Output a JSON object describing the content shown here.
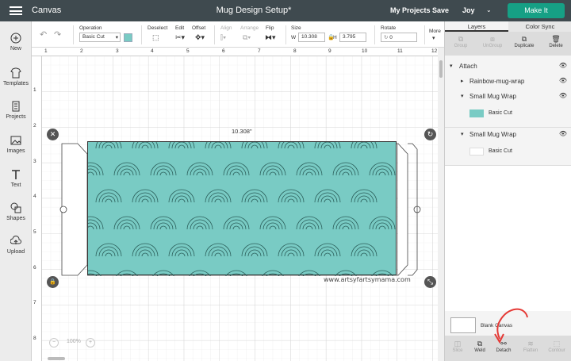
{
  "app": {
    "name": "Canvas",
    "title": "Mug Design Setup*",
    "my_projects": "My Projects",
    "save": "Save",
    "user": "Joy",
    "make_it": "Make It"
  },
  "sidebar": {
    "items": [
      {
        "label": "New"
      },
      {
        "label": "Templates"
      },
      {
        "label": "Projects"
      },
      {
        "label": "Images"
      },
      {
        "label": "Text"
      },
      {
        "label": "Shapes"
      },
      {
        "label": "Upload"
      }
    ]
  },
  "toolbar": {
    "operation_label": "Operation",
    "operation_value": "Basic Cut",
    "deselect": "Deselect",
    "edit": "Edit",
    "offset": "Offset",
    "align": "Align",
    "arrange": "Arrange",
    "flip": "Flip",
    "size_label": "Size",
    "w_label": "W",
    "w_value": "10.308",
    "h_label": "H",
    "h_value": "3.795",
    "rotate_label": "Rotate",
    "rotate_value": "0",
    "more": "More"
  },
  "rulers": {
    "h": [
      "1",
      "2",
      "3",
      "4",
      "5",
      "6",
      "7",
      "8",
      "9",
      "10",
      "11",
      "12"
    ],
    "v": [
      "1",
      "2",
      "3",
      "4",
      "5",
      "6",
      "7",
      "8"
    ]
  },
  "canvas": {
    "width_label": "10.308\"",
    "zoom": "100%",
    "watermark": "www.artsyfartsymama.com",
    "accent": "#79cbc4"
  },
  "panel": {
    "tabs": [
      "Layers",
      "Color Sync"
    ],
    "tools": [
      "Group",
      "UnGroup",
      "Duplicate",
      "Delete"
    ],
    "layers": [
      {
        "name": "Attach"
      },
      {
        "name": "Rainbow-mug-wrap"
      },
      {
        "name": "Small Mug Wrap",
        "sub": "Basic Cut"
      },
      {
        "name": "Small Mug Wrap",
        "sub": "Basic Cut"
      }
    ],
    "blank_canvas": "Blank Canvas",
    "bottom_tools": [
      "Slice",
      "Weld",
      "Detach",
      "Flatten",
      "Contour"
    ]
  }
}
